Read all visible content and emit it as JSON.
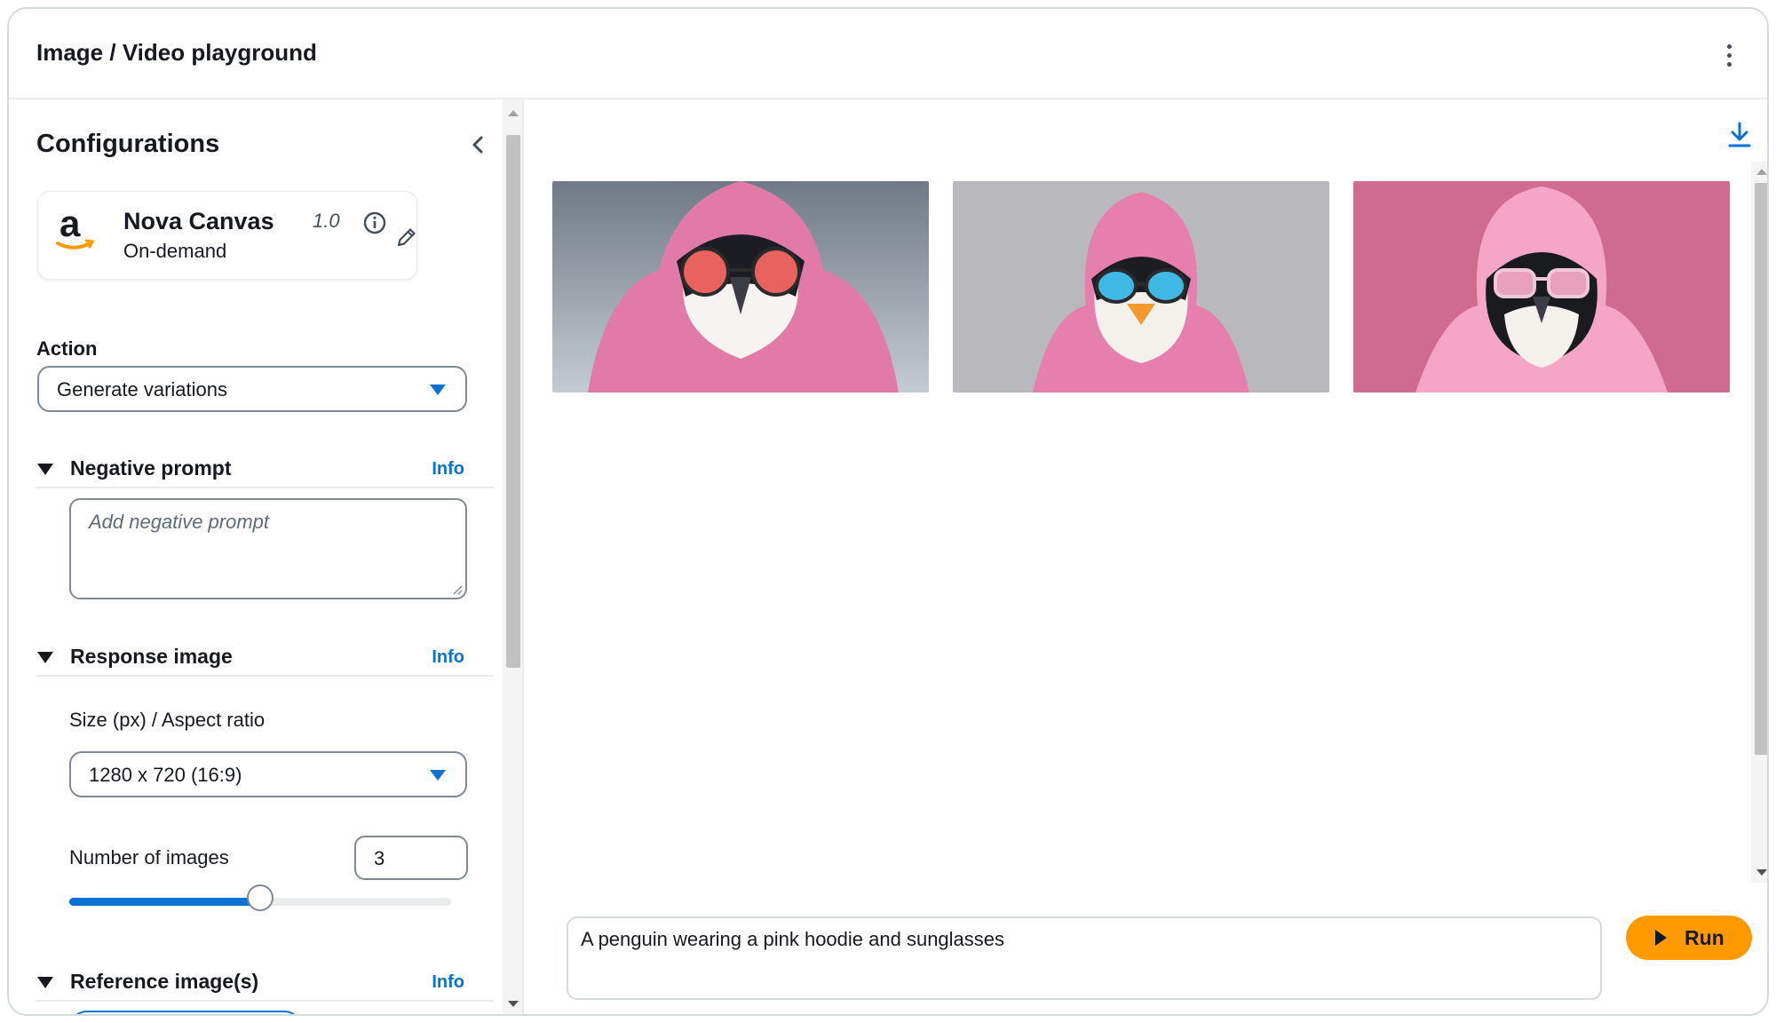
{
  "header": {
    "title": "Image / Video playground"
  },
  "config": {
    "title": "Configurations",
    "model": {
      "name": "Nova Canvas",
      "version": "1.0",
      "mode": "On-demand"
    },
    "action": {
      "label": "Action",
      "value": "Generate variations"
    },
    "negative_prompt": {
      "title": "Negative prompt",
      "info": "Info",
      "placeholder": "Add negative prompt"
    },
    "response_image": {
      "title": "Response image",
      "info": "Info",
      "size_label": "Size (px) / Aspect ratio",
      "size_value": "1280 x 720 (16:9)",
      "count_label": "Number of images",
      "count_value": "3",
      "slider_fraction": 0.5
    },
    "reference_images": {
      "title": "Reference image(s)",
      "info": "Info"
    }
  },
  "gallery": {
    "images": [
      {
        "icon": "penguin-pink-hoodie-image-1"
      },
      {
        "icon": "penguin-pink-hoodie-image-2"
      },
      {
        "icon": "penguin-pink-hoodie-image-3"
      }
    ]
  },
  "prompt": {
    "value": "A penguin wearing a pink hoodie and sunglasses"
  },
  "run_button": {
    "label": "Run"
  },
  "colors": {
    "accent": "#0972d3",
    "run": "#ff9900",
    "border": "#7d8998"
  }
}
